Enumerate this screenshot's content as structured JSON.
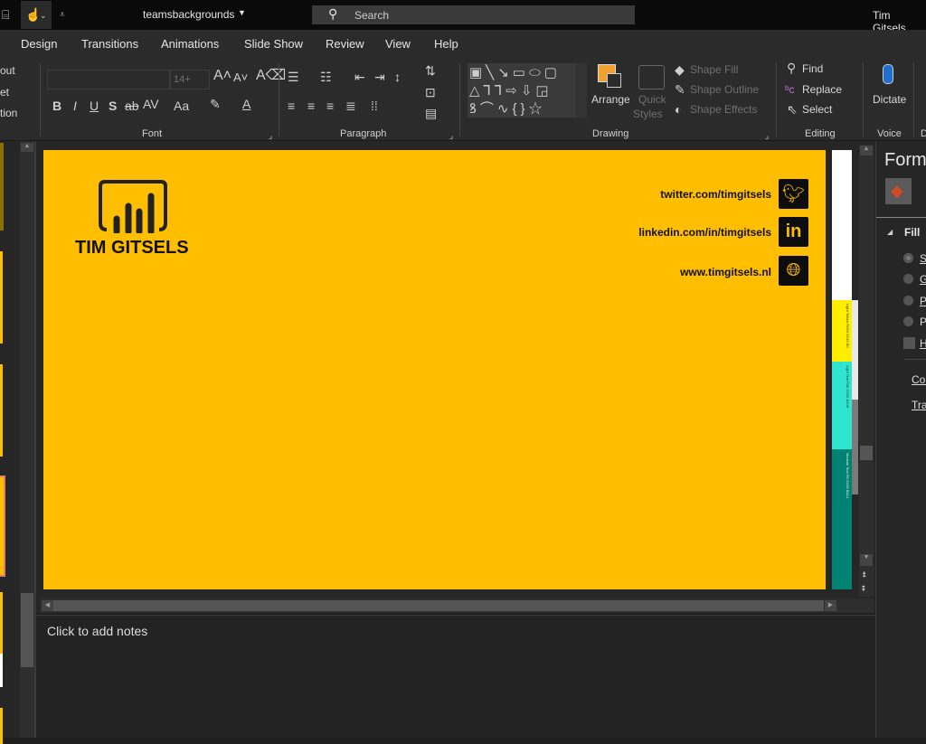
{
  "titlebar": {
    "filename": "teamsbackgrounds",
    "search_placeholder": "Search",
    "user": "Tim Gitsels"
  },
  "tabs": [
    "Design",
    "Transitions",
    "Animations",
    "Slide Show",
    "Review",
    "View",
    "Help"
  ],
  "ribbon": {
    "left_cut": [
      "out",
      "et",
      "tion"
    ],
    "font": {
      "size": "14+",
      "group": "Font",
      "bold": "B",
      "italic": "I",
      "underline": "U",
      "shadow": "S",
      "strike": "ab",
      "spacing": "AV",
      "case": "Aa"
    },
    "paragraph": {
      "group": "Paragraph"
    },
    "drawing": {
      "arrange": "Arrange",
      "quick_styles_1": "Quick",
      "quick_styles_2": "Styles",
      "shape_fill": "Shape Fill",
      "shape_outline": "Shape Outline",
      "shape_effects": "Shape Effects",
      "group": "Drawing"
    },
    "editing": {
      "find": "Find",
      "replace": "Replace",
      "select": "Select",
      "group": "Editing"
    },
    "voice": {
      "dictate": "Dictate",
      "group": "Voice"
    },
    "next_group": "D"
  },
  "slide": {
    "brand": "TIM GITSELS",
    "background": "#FFBE00",
    "links": [
      "twitter.com/timgitsels",
      "linkedin.com/in/timgitsels",
      "www.timgitsels.nl"
    ]
  },
  "swatches": [
    {
      "label": "Light Yellow R254 G240 B0",
      "color": "#FFEE00"
    },
    {
      "label": "Light Teal R48 G229 B208",
      "color": "#30E5D0"
    },
    {
      "label": "Medium Teal R0 G130 B114",
      "color": "#008272"
    }
  ],
  "notes": {
    "placeholder": "Click to add notes"
  },
  "format_pane": {
    "title": "Form",
    "section": "Fill",
    "options": [
      "S",
      "G",
      "P",
      "P",
      "H"
    ],
    "color_label": "Col",
    "transparency_label": "Tra"
  }
}
